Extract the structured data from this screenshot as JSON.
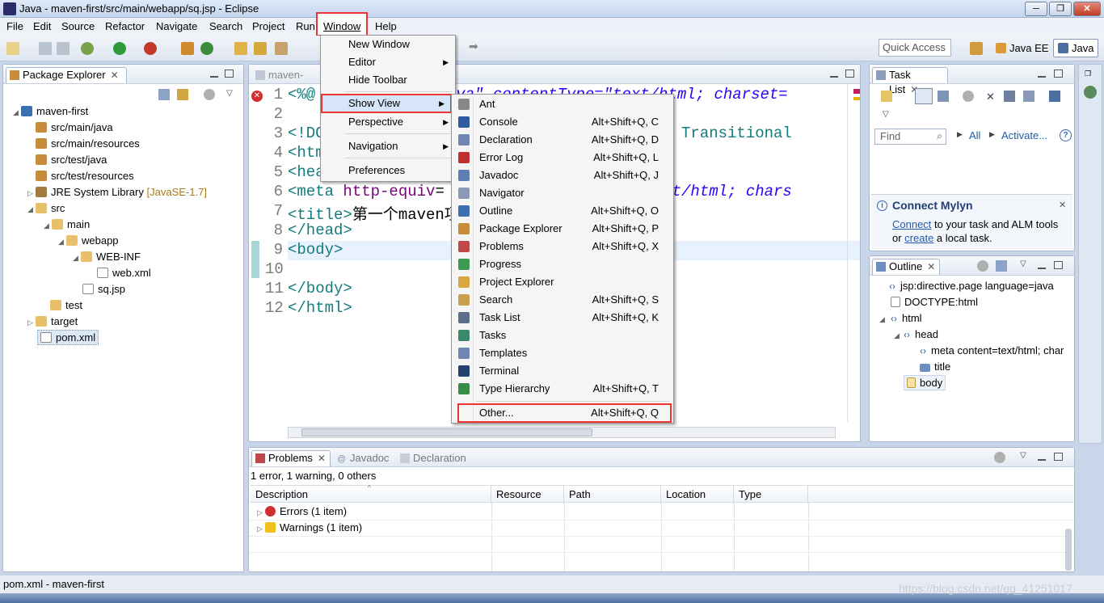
{
  "window": {
    "title": "Java - maven-first/src/main/webapp/sq.jsp - Eclipse"
  },
  "menubar": {
    "file": "File",
    "edit": "Edit",
    "source": "Source",
    "refactor": "Refactor",
    "navigate": "Navigate",
    "search": "Search",
    "project": "Project",
    "run": "Run",
    "window": "Window",
    "help": "Help"
  },
  "toolbar": {
    "quick_access_placeholder": "Quick Access",
    "perspective_javaee": "Java EE",
    "perspective_java": "Java"
  },
  "package_explorer": {
    "tab": "Package Explorer",
    "tree": [
      {
        "label": "maven-first",
        "decor": ""
      },
      {
        "label": "src/main/java",
        "decor": ""
      },
      {
        "label": "src/main/resources",
        "decor": ""
      },
      {
        "label": "src/test/java",
        "decor": ""
      },
      {
        "label": "src/test/resources",
        "decor": ""
      },
      {
        "label": "JRE System Library",
        "decor": "[JavaSE-1.7]"
      },
      {
        "label": "src",
        "decor": ""
      },
      {
        "label": "main",
        "decor": ""
      },
      {
        "label": "webapp",
        "decor": ""
      },
      {
        "label": "WEB-INF",
        "decor": ""
      },
      {
        "label": "web.xml",
        "decor": ""
      },
      {
        "label": "sq.jsp",
        "decor": ""
      },
      {
        "label": "test",
        "decor": ""
      },
      {
        "label": "target",
        "decor": ""
      },
      {
        "label": "pom.xml",
        "decor": ""
      }
    ]
  },
  "editor": {
    "tab": "maven-first",
    "lines": [
      {
        "n": "1",
        "html": "<span class=\"tag\">&lt;%@</span>"
      },
      {
        "n": "2",
        "html": ""
      },
      {
        "n": "3",
        "html": "<span class=\"tag\">&lt;!DO</span>"
      },
      {
        "n": "4",
        "html": "<span class=\"tag\">&lt;htm</span>"
      },
      {
        "n": "5",
        "html": "<span class=\"tag\">&lt;hea</span>"
      },
      {
        "n": "6",
        "html": "<span class=\"tag\">&lt;meta</span> <span class=\"attr\">http-equiv</span>="
      },
      {
        "n": "7",
        "html": "<span class=\"tag\">&lt;title&gt;</span>第一个maven项"
      },
      {
        "n": "8",
        "html": "<span class=\"tag\">&lt;/head&gt;</span>"
      },
      {
        "n": "9",
        "html": "<span class=\"tag\">&lt;body&gt;</span>"
      },
      {
        "n": "10",
        "html": ""
      },
      {
        "n": "11",
        "html": "<span class=\"tag\">&lt;/body&gt;</span>"
      },
      {
        "n": "12",
        "html": "<span class=\"tag\">&lt;/html&gt;</span>"
      }
    ],
    "right_fragments": [
      {
        "line": "1",
        "text": "\"java\" contentType=\"text/html; charset="
      },
      {
        "line": "3",
        "text": "4.01 Transitional"
      },
      {
        "line": "6",
        "text": "\"text/html; chars"
      }
    ]
  },
  "window_menu": {
    "items": [
      "New Window",
      "Editor",
      "Hide Toolbar",
      "Show View",
      "Perspective",
      "Navigation",
      "Preferences"
    ]
  },
  "show_view_menu": {
    "items": [
      {
        "label": "Ant",
        "accel": ""
      },
      {
        "label": "Console",
        "accel": "Alt+Shift+Q, C"
      },
      {
        "label": "Declaration",
        "accel": "Alt+Shift+Q, D"
      },
      {
        "label": "Error Log",
        "accel": "Alt+Shift+Q, L"
      },
      {
        "label": "Javadoc",
        "accel": "Alt+Shift+Q, J"
      },
      {
        "label": "Navigator",
        "accel": ""
      },
      {
        "label": "Outline",
        "accel": "Alt+Shift+Q, O"
      },
      {
        "label": "Package Explorer",
        "accel": "Alt+Shift+Q, P"
      },
      {
        "label": "Problems",
        "accel": "Alt+Shift+Q, X"
      },
      {
        "label": "Progress",
        "accel": ""
      },
      {
        "label": "Project Explorer",
        "accel": ""
      },
      {
        "label": "Search",
        "accel": "Alt+Shift+Q, S"
      },
      {
        "label": "Task List",
        "accel": "Alt+Shift+Q, K"
      },
      {
        "label": "Tasks",
        "accel": ""
      },
      {
        "label": "Templates",
        "accel": ""
      },
      {
        "label": "Terminal",
        "accel": ""
      },
      {
        "label": "Type Hierarchy",
        "accel": "Alt+Shift+Q, T"
      },
      {
        "label": "Other...",
        "accel": "Alt+Shift+Q, Q"
      }
    ]
  },
  "task_list": {
    "tab": "Task List",
    "find_placeholder": "Find",
    "all": "All",
    "activate": "Activate...",
    "mylyn_title": "Connect Mylyn",
    "mylyn_connect": "Connect",
    "mylyn_text1": " to your task and ALM tools",
    "mylyn_or": "or ",
    "mylyn_create": "create",
    "mylyn_text2": " a local task."
  },
  "outline": {
    "tab": "Outline",
    "items": [
      "jsp:directive.page language=java",
      "DOCTYPE:html",
      "html",
      "head",
      "meta content=text/html; char",
      "title",
      "body"
    ]
  },
  "problems": {
    "tabs": [
      "Problems",
      "Javadoc",
      "Declaration"
    ],
    "summary": "1 error, 1 warning, 0 others",
    "columns": [
      "Description",
      "Resource",
      "Path",
      "Location",
      "Type"
    ],
    "rows": [
      "Errors (1 item)",
      "Warnings (1 item)"
    ]
  },
  "status": {
    "text": "pom.xml - maven-first",
    "watermark": "https://blog.csdn.net/qq_41251017"
  },
  "colors": {
    "highlight": "#e33333",
    "selection": "#cfe0f7"
  }
}
